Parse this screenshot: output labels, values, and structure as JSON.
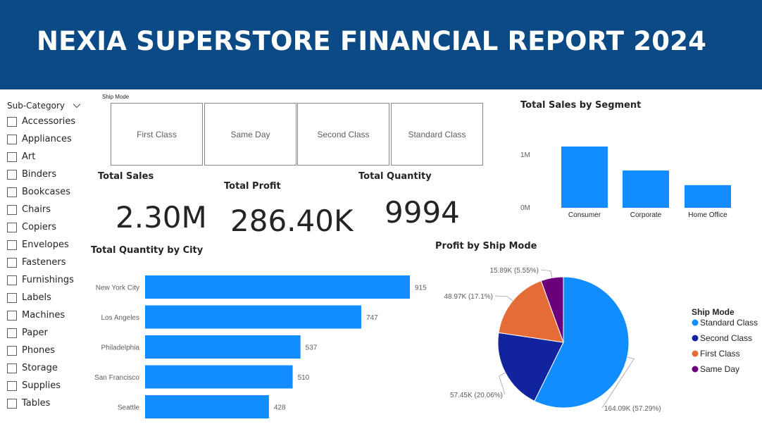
{
  "header": {
    "title": "NEXIA SUPERSTORE FINANCIAL REPORT 2024"
  },
  "colors": {
    "header_bg": "#0c4a86",
    "accent": "#118dff",
    "second_class": "#12239e",
    "first_class": "#e66c37",
    "same_day": "#6b007b"
  },
  "slicer": {
    "title": "Sub-Category",
    "icon": "chevron-down-icon",
    "items": [
      "Accessories",
      "Appliances",
      "Art",
      "Binders",
      "Bookcases",
      "Chairs",
      "Copiers",
      "Envelopes",
      "Fasteners",
      "Furnishings",
      "Labels",
      "Machines",
      "Paper",
      "Phones",
      "Storage",
      "Supplies",
      "Tables"
    ]
  },
  "ship_mode_slicer": {
    "title": "Ship Mode",
    "options": [
      "First Class",
      "Same Day",
      "Second Class",
      "Standard Class"
    ]
  },
  "kpis": {
    "total_sales": {
      "label": "Total Sales",
      "value": "2.30M"
    },
    "total_profit": {
      "label": "Total Profit",
      "value": "286.40K"
    },
    "total_quantity": {
      "label": "Total Quantity",
      "value": "9994"
    }
  },
  "chart_data": [
    {
      "type": "bar",
      "title": "Total Sales by Segment",
      "categories": [
        "Consumer",
        "Corporate",
        "Home Office"
      ],
      "values": [
        1160000,
        706000,
        429000
      ],
      "y_ticks": [
        "0M",
        "1M"
      ],
      "ylim": [
        0,
        1400000
      ],
      "grid": false
    },
    {
      "type": "bar",
      "orientation": "horizontal",
      "title": "Total Quantity by City",
      "categories": [
        "New York City",
        "Los Angeles",
        "Philadelphia",
        "San Francisco",
        "Seattle"
      ],
      "values": [
        915,
        747,
        537,
        510,
        428
      ],
      "data_labels": [
        "915",
        "747",
        "537",
        "510",
        "428"
      ],
      "grid": false
    },
    {
      "type": "pie",
      "title": "Profit by Ship Mode",
      "legend_title": "Ship Mode",
      "legend_position": "right",
      "series": [
        {
          "name": "Standard Class",
          "value": 164.09,
          "percent": 57.29,
          "label": "164.09K (57.29%)",
          "color": "#118dff"
        },
        {
          "name": "Second Class",
          "value": 57.45,
          "percent": 20.06,
          "label": "57.45K (20.06%)",
          "color": "#12239e"
        },
        {
          "name": "First Class",
          "value": 48.97,
          "percent": 17.1,
          "label": "48.97K (17.1%)",
          "color": "#e66c37"
        },
        {
          "name": "Same Day",
          "value": 15.89,
          "percent": 5.55,
          "label": "15.89K (5.55%)",
          "color": "#6b007b"
        }
      ]
    }
  ]
}
